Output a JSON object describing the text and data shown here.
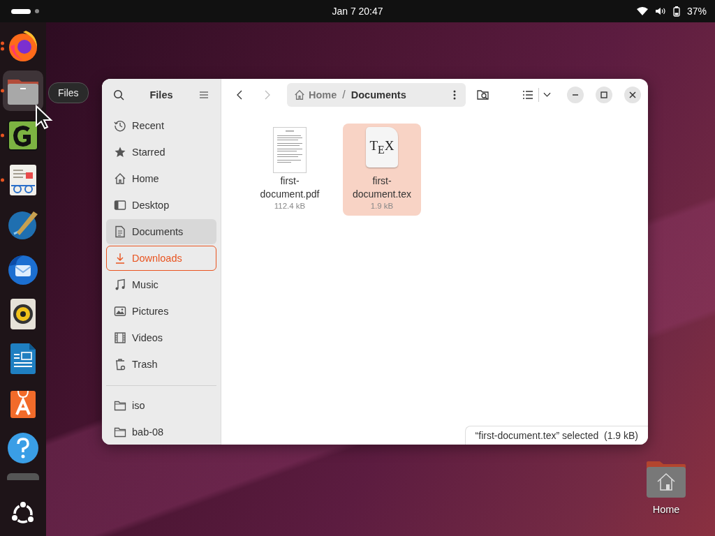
{
  "top_bar": {
    "clock": "Jan 7  20:47",
    "battery": "37%"
  },
  "dock": {
    "items": [
      {
        "kind": "firefox",
        "running": true,
        "multiple_windows": true,
        "focused": false
      },
      {
        "kind": "files",
        "running": true,
        "multiple_windows": false,
        "focused": true
      },
      {
        "kind": "gnumeric",
        "running": true,
        "multiple_windows": false,
        "focused": false
      },
      {
        "kind": "reader",
        "running": true,
        "multiple_windows": false,
        "focused": false
      },
      {
        "kind": "scribus",
        "running": false,
        "focused": false
      },
      {
        "kind": "thunderbird",
        "running": false,
        "focused": false
      },
      {
        "kind": "rhythmbox",
        "running": false,
        "focused": false
      },
      {
        "kind": "writer",
        "running": false,
        "focused": false
      },
      {
        "kind": "appcenter",
        "running": false,
        "focused": false
      },
      {
        "kind": "help",
        "running": false,
        "focused": false
      }
    ],
    "tooltip": "Files"
  },
  "window": {
    "title": "Files",
    "sidebar": {
      "places": [
        {
          "label": "Recent",
          "kind": "recent",
          "selected": false,
          "highlighted": false
        },
        {
          "label": "Starred",
          "kind": "starred",
          "selected": false,
          "highlighted": false
        },
        {
          "label": "Home",
          "kind": "home",
          "selected": false,
          "highlighted": false
        },
        {
          "label": "Desktop",
          "kind": "desktop",
          "selected": false,
          "highlighted": false
        },
        {
          "label": "Documents",
          "kind": "documents",
          "selected": true,
          "highlighted": false
        },
        {
          "label": "Downloads",
          "kind": "downloads",
          "selected": false,
          "highlighted": true
        },
        {
          "label": "Music",
          "kind": "music",
          "selected": false,
          "highlighted": false
        },
        {
          "label": "Pictures",
          "kind": "pictures",
          "selected": false,
          "highlighted": false
        },
        {
          "label": "Videos",
          "kind": "videos",
          "selected": false,
          "highlighted": false
        },
        {
          "label": "Trash",
          "kind": "trash",
          "selected": false,
          "highlighted": false
        }
      ],
      "bookmarks": [
        {
          "label": "iso",
          "selected": false
        },
        {
          "label": "bab-08",
          "selected": false
        }
      ]
    },
    "path": [
      "Home",
      "Documents"
    ],
    "path_separator": "/",
    "files": [
      {
        "name": "first-document.pdf",
        "size": "112.4 kB",
        "kind": "pdf",
        "selected": false
      },
      {
        "name": "first-document.tex",
        "size": "1.9 kB",
        "kind": "tex",
        "icon_text": "T$_{E}$X",
        "selected": true
      }
    ],
    "status": "“first-document.tex” selected  (1.9 kB)"
  },
  "desktop_icons": [
    {
      "label": "Home",
      "kind": "home-folder"
    }
  ]
}
